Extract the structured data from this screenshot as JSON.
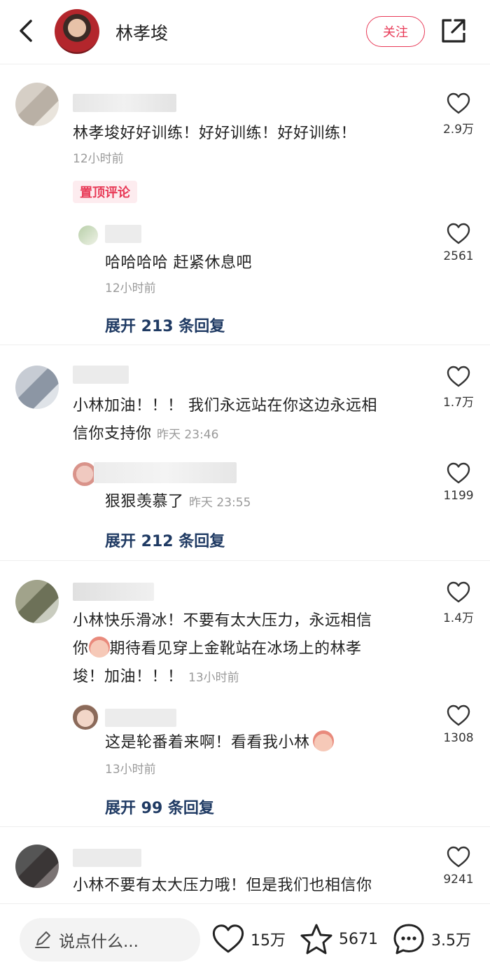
{
  "header": {
    "title": "林孝埈",
    "follow_label": "关注"
  },
  "comments": [
    {
      "text": "林孝埈好好训练！好好训练！好好训练！",
      "time": "12小时前",
      "likes": "2.9万",
      "badge": "置顶评论",
      "reply": {
        "text": "哈哈哈哈 赶紧休息吧",
        "time": "12小时前",
        "likes": "2561"
      },
      "expand": "展开 213 条回复"
    },
    {
      "text_line1": "小林加油！！！ 我们永远站在你这边永远相",
      "text_line2": "信你支持你",
      "time": "昨天 23:46",
      "likes": "1.7万",
      "reply": {
        "text": "狠狠羡慕了",
        "time": "昨天 23:55",
        "likes": "1199"
      },
      "expand": "展开 212 条回复"
    },
    {
      "text_line1": "小林快乐滑冰！不要有太大压力，永远相信",
      "text_line2a": "你",
      "text_line2b": "期待看见穿上金靴站在冰场上的林孝",
      "text_line3": "埈！加油！！！",
      "time": "13小时前",
      "likes": "1.4万",
      "reply": {
        "text": "这是轮番着来啊！看看我小林",
        "time": "13小时前",
        "likes": "1308"
      },
      "expand": "展开 99 条回复"
    },
    {
      "text": "小林不要有太大压力哦！但是我们也相信你",
      "likes": "9241"
    }
  ],
  "bottom": {
    "placeholder": "说点什么...",
    "likes": "15万",
    "favorites": "5671",
    "comments": "3.5万"
  },
  "colors": {
    "accent": "#e83a57",
    "expand": "#1f3a63",
    "time": "#9a9a9a"
  }
}
